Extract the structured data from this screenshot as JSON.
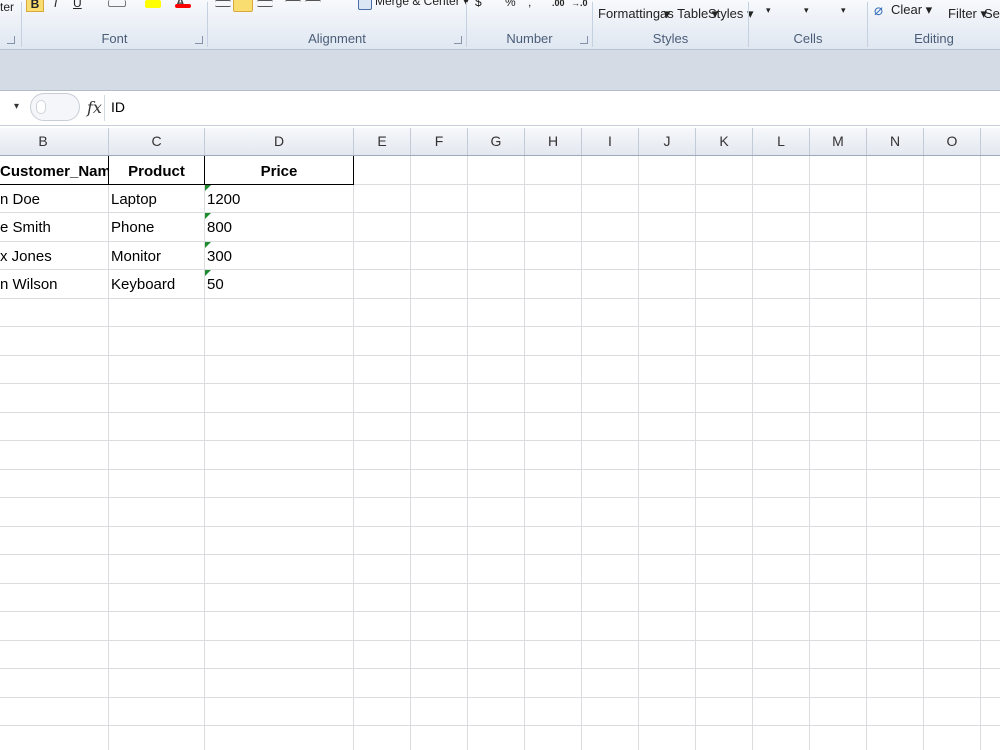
{
  "ribbon": {
    "partial_left_label": "ter",
    "bold_label": "B",
    "italic_label": "I",
    "underline_label": "U",
    "fill_color": "#ffff00",
    "font_color": "#ff0000",
    "font_color_letter": "A",
    "merge_center_label": "Merge & Center",
    "merge_dropdown": "▾",
    "currency_symbol": "$",
    "percent_symbol": "%",
    "comma_symbol": ",",
    "dec_increase": ".00",
    "dec_decrease": "→.0",
    "cond_formatting_label": "Formatting ▾",
    "format_as_table_label": "as Table ▾",
    "cell_styles_label": "Styles ▾",
    "cells_dropdown_arrows": "▾",
    "clear_label": "Clear ▾",
    "filter_label": "Filter ▾",
    "select_label": "Sel",
    "groups": {
      "font": "Font",
      "alignment": "Alignment",
      "number": "Number",
      "styles": "Styles",
      "cells": "Cells",
      "editing": "Editing"
    }
  },
  "formula_bar": {
    "namebox_dropdown": "▾",
    "fx_label": "fx",
    "value": "ID"
  },
  "sheet": {
    "columns": [
      "B",
      "C",
      "D",
      "E",
      "F",
      "G",
      "H",
      "I",
      "J",
      "K",
      "L",
      "M",
      "N",
      "O"
    ],
    "headers": {
      "customer_name": "Customer_Name",
      "product": "Product",
      "price": "Price"
    },
    "rows": [
      {
        "customer_name": "n Doe",
        "product": "Laptop",
        "price": "1200"
      },
      {
        "customer_name": "e Smith",
        "product": "Phone",
        "price": "800"
      },
      {
        "customer_name": "x Jones",
        "product": "Monitor",
        "price": "300"
      },
      {
        "customer_name": "n Wilson",
        "product": "Keyboard",
        "price": "50"
      }
    ],
    "error_indicator_color": "#1e8c2e"
  }
}
